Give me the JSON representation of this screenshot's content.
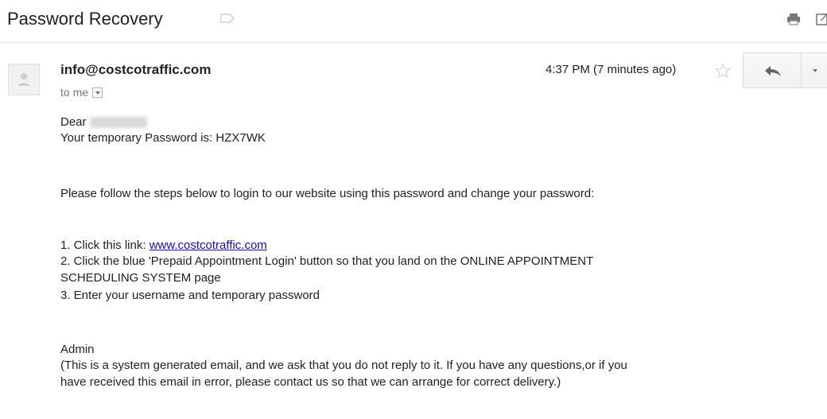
{
  "email": {
    "subject": "Password Recovery",
    "sender": "info@costcotraffic.com",
    "to_label": "to me",
    "timestamp": "4:37 PM (7 minutes ago)",
    "greeting": "Dear",
    "temp_password_line": "Your temporary Password is: HZX7WK",
    "instructions_intro": "Please follow the steps below to login to our website using this password and change your password:",
    "step1_prefix": "1. Click this link: ",
    "step1_link": "www.costcotraffic.com",
    "step2": "2. Click the blue 'Prepaid Appointment Login' button so that you land on the ONLINE APPOINTMENT",
    "step2_cont": "SCHEDULING SYSTEM page",
    "step3": "3. Enter your username and temporary password",
    "signoff": "Admin",
    "disclaimer_line1": "(This is a system generated email, and we ask that you do not reply to it. If you have any questions,or if you",
    "disclaimer_line2": "have received this email in error, please contact us so that we can arrange for correct delivery.)"
  },
  "icons": {
    "label": "label-icon",
    "print": "print-icon",
    "new_window": "new-window-icon",
    "avatar": "avatar-icon",
    "star": "star-icon",
    "reply": "reply-icon",
    "more": "chevron-down-icon"
  },
  "colors": {
    "link": "#1a0dab",
    "border": "#dcdcdc"
  }
}
